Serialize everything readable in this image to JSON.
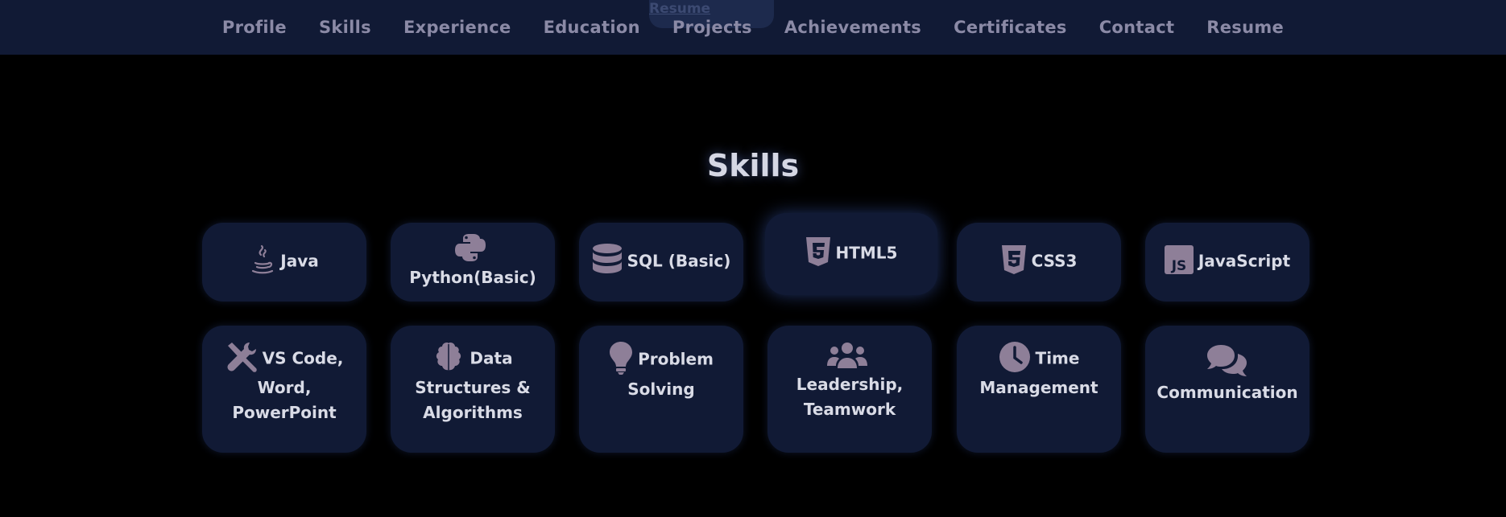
{
  "nav": {
    "download_resume": "Download Resume",
    "links": [
      "Profile",
      "Skills",
      "Experience",
      "Education",
      "Projects",
      "Achievements",
      "Certificates",
      "Contact",
      "Resume"
    ]
  },
  "skills": {
    "title": "Skills",
    "row1": [
      {
        "label": "Java",
        "icon": "java-icon"
      },
      {
        "label": "Python(Basic)",
        "icon": "python-icon"
      },
      {
        "label": "SQL (Basic)",
        "icon": "database-icon"
      },
      {
        "label": "HTML5",
        "icon": "html5-icon"
      },
      {
        "label": "CSS3",
        "icon": "css3-icon"
      },
      {
        "label": "JavaScript",
        "icon": "js-icon"
      }
    ],
    "row2": [
      {
        "label": "VS Code, Word, PowerPoint",
        "icon": "tools-icon"
      },
      {
        "label": "Data Structures & Algorithms",
        "icon": "brain-icon"
      },
      {
        "label": "Problem Solving",
        "icon": "lightbulb-icon"
      },
      {
        "label": "Leadership, Teamwork",
        "icon": "users-icon"
      },
      {
        "label": "Time Management",
        "icon": "clock-icon"
      },
      {
        "label": "Communication",
        "icon": "comments-icon"
      }
    ]
  },
  "colors": {
    "background": "#000000",
    "navbar": "#111a35",
    "card": "#111a35",
    "icon": "#8e7f98",
    "text": "#d9dbe6"
  }
}
